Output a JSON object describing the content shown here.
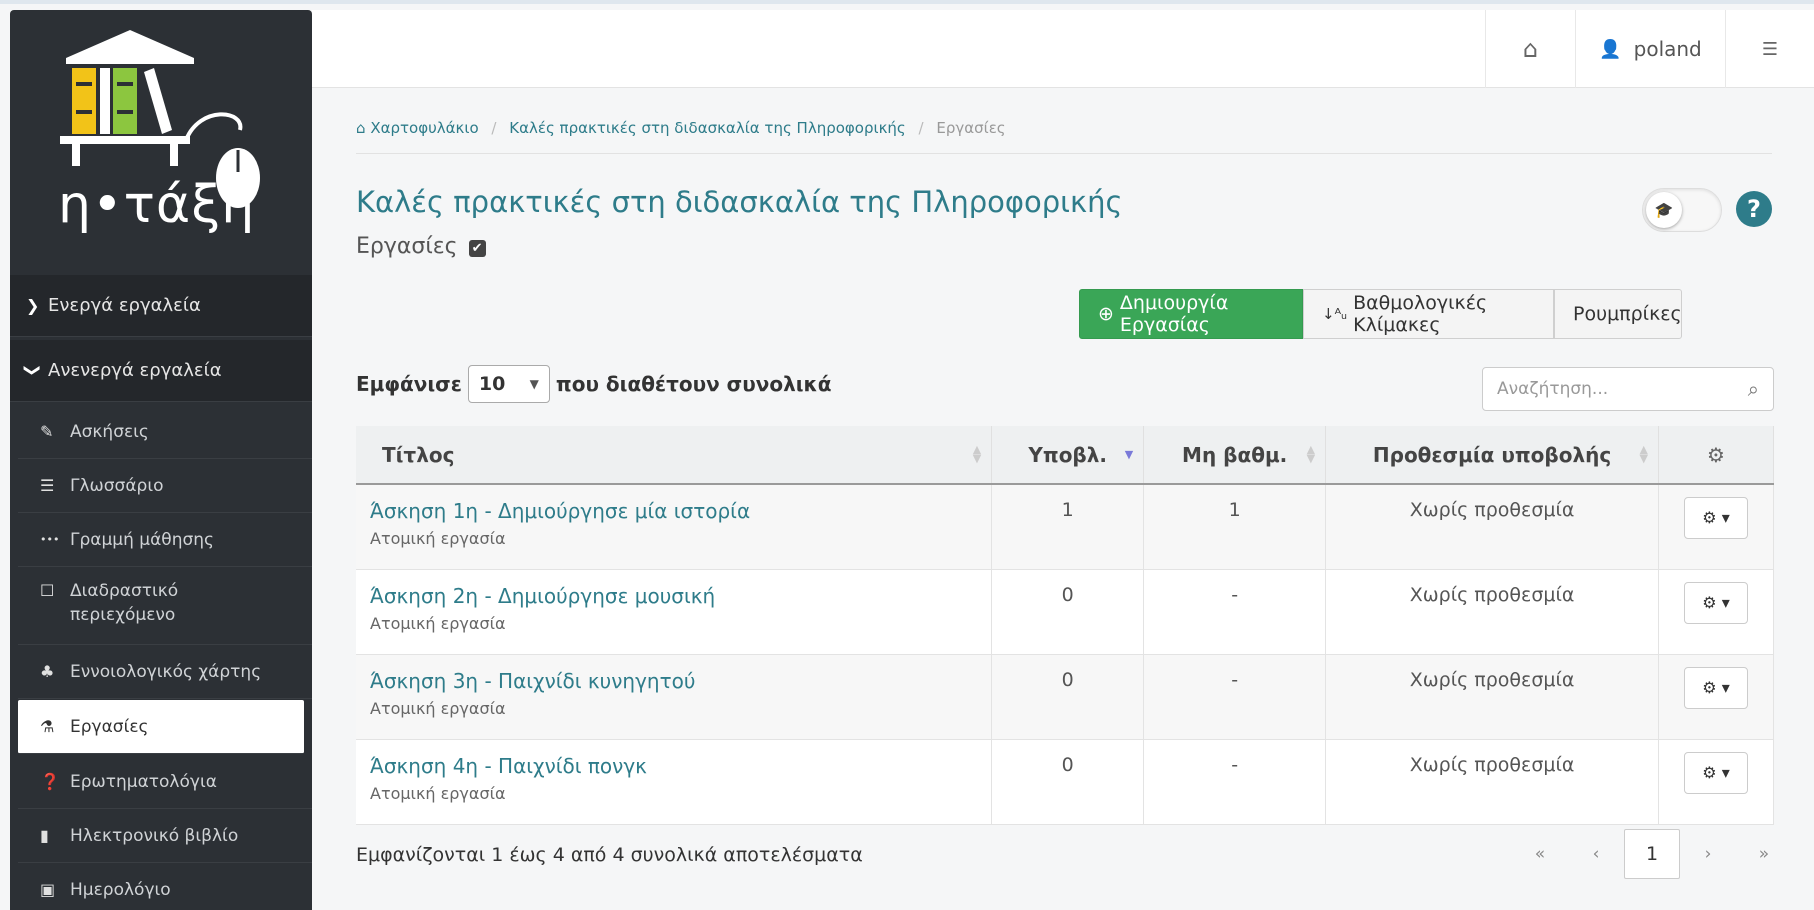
{
  "brand": {
    "logo_text": "η•τάξη"
  },
  "sidebar": {
    "groups": [
      {
        "label": "Ενεργά εργαλεία",
        "icon": "chevron-right-icon",
        "glyph": "❯"
      },
      {
        "label": "Ανενεργά εργαλεία",
        "icon": "chevron-down-icon",
        "glyph": "❯"
      }
    ],
    "items": [
      {
        "label": "Ασκήσεις",
        "icon": "edit-icon",
        "glyph": "✎"
      },
      {
        "label": "Γλωσσάριο",
        "icon": "list-icon",
        "glyph": "☰"
      },
      {
        "label": "Γραμμή μάθησης",
        "icon": "ellipsis-icon",
        "glyph": "•••"
      },
      {
        "label": "Διαδραστικό περιεχόμενο",
        "icon": "square-icon",
        "glyph": "☐"
      },
      {
        "label": "Εννοιολογικός χάρτης",
        "icon": "sitemap-icon",
        "glyph": "♣"
      },
      {
        "label": "Εργασίες",
        "icon": "flask-icon",
        "glyph": "⚗"
      },
      {
        "label": "Ερωτηματολόγια",
        "icon": "question-circle-icon",
        "glyph": "❓"
      },
      {
        "label": "Ηλεκτρονικό βιβλίο",
        "icon": "book-icon",
        "glyph": "▮"
      },
      {
        "label": "Ημερολόγιο",
        "icon": "calendar-icon",
        "glyph": "▣"
      }
    ]
  },
  "topbar": {
    "home_icon": "⌂",
    "user_icon": "👤",
    "username": "poland",
    "settings_icon": "☰"
  },
  "breadcrumb": {
    "home_glyph": "⌂",
    "items": [
      "Χαρτοφυλάκιο",
      "Καλές πρακτικές στη διδασκαλία της Πληροφορικής",
      "Εργασίες"
    ],
    "separator": "/"
  },
  "page": {
    "title": "Καλές πρακτικές στη διδασκαλία της Πληροφορικής",
    "subtitle": "Εργασίες",
    "check_glyph": "✔",
    "help_glyph": "?",
    "toggle_glyph": "🎓"
  },
  "actions": {
    "create_label": "Δημιουργία Εργασίας",
    "create_glyph": "⊕",
    "scales_label": "Βαθμολογικές Κλίμακες",
    "scales_glyph": "↓ᴬᵤ",
    "rubrics_label": "Ρουμπρίκες"
  },
  "table_controls": {
    "show_label": "Εμφάνισε",
    "page_length": "10",
    "total_label": "που διαθέτουν συνολικά",
    "search_placeholder": "Αναζήτηση...",
    "search_glyph": "⌕"
  },
  "table": {
    "headers": [
      "Τίτλος",
      "Υποβλ.",
      "Μη βαθμ.",
      "Προθεσμία υποβολής",
      "⚙"
    ],
    "rows": [
      {
        "title": "Άσκηση 1η - Δημιούργησε μία ιστορία",
        "type": "Ατομική εργασία",
        "submissions": "1",
        "ungraded": "1",
        "deadline": "Χωρίς προθεσμία",
        "action": "⚙ ▾"
      },
      {
        "title": "Άσκηση 2η - Δημιούργησε μουσική",
        "type": "Ατομική εργασία",
        "submissions": "0",
        "ungraded": "-",
        "deadline": "Χωρίς προθεσμία",
        "action": "⚙ ▾"
      },
      {
        "title": "Άσκηση 3η - Παιχνίδι κυνηγητού",
        "type": "Ατομική εργασία",
        "submissions": "0",
        "ungraded": "-",
        "deadline": "Χωρίς προθεσμία",
        "action": "⚙ ▾"
      },
      {
        "title": "Άσκηση 4η - Παιχνίδι πονγκ",
        "type": "Ατομική εργασία",
        "submissions": "0",
        "ungraded": "-",
        "deadline": "Χωρίς προθεσμία",
        "action": "⚙ ▾"
      }
    ]
  },
  "footer": {
    "info": "Εμφανίζονται 1 έως 4 από 4 συνολικά αποτελέσματα",
    "pager": {
      "first": "«",
      "prev": "‹",
      "current": "1",
      "next": "›",
      "last": "»"
    }
  },
  "colors": {
    "accent": "#2e7c8a",
    "success": "#3aa657",
    "sidebar": "#2c3035"
  }
}
